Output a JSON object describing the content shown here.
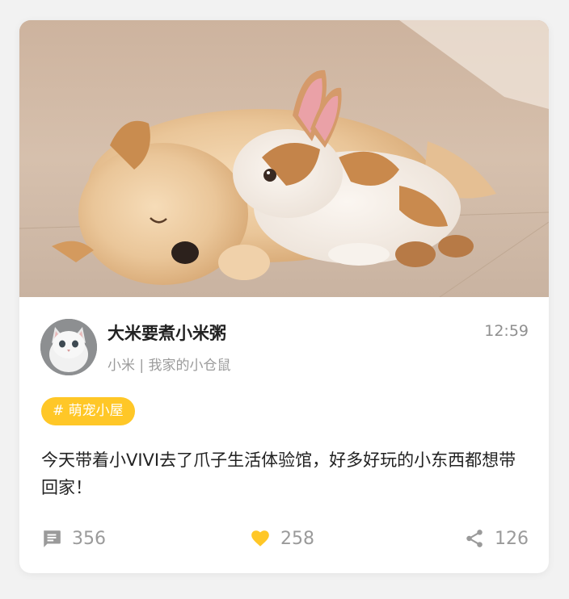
{
  "post": {
    "author_name": "大米要煮小米粥",
    "author_meta": "小米 | 我家的小仓鼠",
    "time": "12:59",
    "tag": "# 萌宠小屋",
    "content": "今天带着小VIVI去了爪子生活体验馆，好多好玩的小东西都想带回家！"
  },
  "actions": {
    "comments": "356",
    "likes": "258",
    "shares": "126"
  },
  "icons": {
    "comment": "comment-icon",
    "like": "heart-icon",
    "share": "share-icon"
  },
  "colors": {
    "tag_bg": "#ffc727",
    "like_icon": "#ffc727",
    "icon_gray": "#9a9a9a"
  }
}
